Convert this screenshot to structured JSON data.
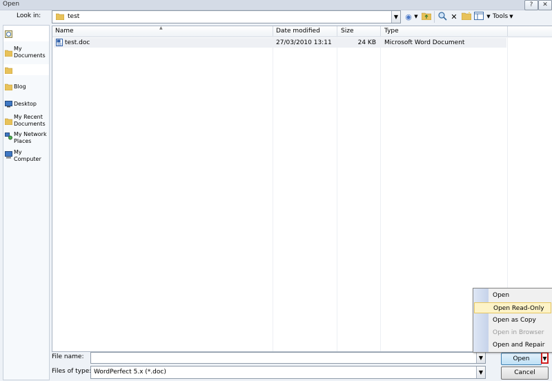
{
  "window": {
    "title": "Open",
    "help_glyph": "?",
    "close_glyph": "✕"
  },
  "lookin": {
    "label": "Look in:",
    "value": "test"
  },
  "toolbar": {
    "tools_label": "Tools"
  },
  "places": [
    {
      "label": "",
      "icon": "recent-icon"
    },
    {
      "label": "My Documents",
      "icon": "folder-icon"
    },
    {
      "label": "",
      "icon": "folder-icon"
    },
    {
      "label": "Blog",
      "icon": "folder-icon"
    },
    {
      "label": "Desktop",
      "icon": "desktop-icon"
    },
    {
      "label": "My Recent Documents",
      "icon": "folder-icon"
    },
    {
      "label": "My Network Places",
      "icon": "network-icon"
    },
    {
      "label": "My Computer",
      "icon": "computer-icon"
    }
  ],
  "columns": {
    "name": "Name",
    "date": "Date modified",
    "size": "Size",
    "type": "Type"
  },
  "files": [
    {
      "name": "test.doc",
      "date": "27/03/2010 13:11",
      "size": "24 KB",
      "type": "Microsoft Word Document"
    }
  ],
  "filename": {
    "label": "File name:",
    "value": ""
  },
  "filetype": {
    "label": "Files of type:",
    "value": "WordPerfect 5.x (*.doc)"
  },
  "buttons": {
    "open": "Open",
    "cancel": "Cancel"
  },
  "menu": {
    "items": [
      {
        "label": "Open",
        "state": "normal"
      },
      {
        "label": "Open Read-Only",
        "state": "highlighted"
      },
      {
        "label": "Open as Copy",
        "state": "normal"
      },
      {
        "label": "Open in Browser",
        "state": "disabled"
      },
      {
        "label": "Open and Repair",
        "state": "normal"
      }
    ]
  },
  "colors": {
    "accent": "#3c7fb1",
    "highlight": "#fdf3c7",
    "marker": "#d21d1d"
  }
}
